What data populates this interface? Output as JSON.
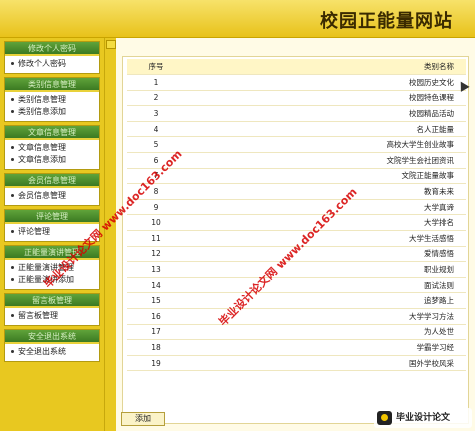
{
  "header": {
    "title": "校园正能量网站"
  },
  "sidebar": {
    "groups": [
      {
        "title": "修改个人密码",
        "items": [
          "修改个人密码"
        ]
      },
      {
        "title": "类别信息管理",
        "items": [
          "类别信息管理",
          "类别信息添加"
        ]
      },
      {
        "title": "文章信息管理",
        "items": [
          "文章信息管理",
          "文章信息添加"
        ]
      },
      {
        "title": "会员信息管理",
        "items": [
          "会员信息管理"
        ]
      },
      {
        "title": "评论管理",
        "items": [
          "评论管理"
        ]
      },
      {
        "title": "正能量演讲管理",
        "items": [
          "正能量演讲管理",
          "正能量演讲添加"
        ]
      },
      {
        "title": "留言板管理",
        "items": [
          "留言板管理"
        ]
      },
      {
        "title": "安全退出系统",
        "items": [
          "安全退出系统"
        ]
      }
    ]
  },
  "table": {
    "headers": {
      "no": "序号",
      "name": "类别名称"
    },
    "rows": [
      {
        "no": "1",
        "name": "校园历史文化"
      },
      {
        "no": "2",
        "name": "校园特色课程"
      },
      {
        "no": "3",
        "name": "校园精品活动"
      },
      {
        "no": "4",
        "name": "名人正能量"
      },
      {
        "no": "5",
        "name": "高校大学生创业故事"
      },
      {
        "no": "6",
        "name": "文院学生会社团资讯"
      },
      {
        "no": "7",
        "name": "文院正能量故事"
      },
      {
        "no": "8",
        "name": "教育未来"
      },
      {
        "no": "9",
        "name": "大学真谛"
      },
      {
        "no": "10",
        "name": "大学排名"
      },
      {
        "no": "11",
        "name": "大学生活感悟"
      },
      {
        "no": "12",
        "name": "爱情感悟"
      },
      {
        "no": "13",
        "name": "职业规划"
      },
      {
        "no": "14",
        "name": "面试法则"
      },
      {
        "no": "15",
        "name": "追梦路上"
      },
      {
        "no": "16",
        "name": "大学学习方法"
      },
      {
        "no": "17",
        "name": "为人处世"
      },
      {
        "no": "18",
        "name": "学霸学习经"
      },
      {
        "no": "19",
        "name": "国外学校风采"
      }
    ]
  },
  "actions": {
    "add_label": "添加"
  },
  "watermarks": {
    "text1": "毕业设计论文网 www.doc163.com",
    "text2": "毕业设计论文网 www.doc163.com"
  },
  "logo": {
    "text": "毕业设计论文"
  },
  "colors": {
    "header": "#e8c21a",
    "menu_head": "#3b7a22",
    "sidebar": "#e8c820"
  }
}
